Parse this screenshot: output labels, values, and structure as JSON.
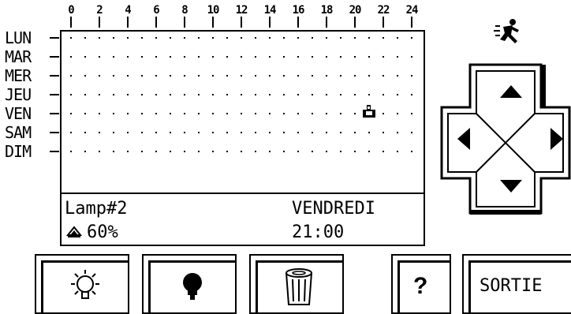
{
  "schedule": {
    "hours": [
      "0",
      "2",
      "4",
      "6",
      "8",
      "10",
      "12",
      "14",
      "16",
      "18",
      "20",
      "22",
      "24"
    ],
    "days": [
      "LUN",
      "MAR",
      "MER",
      "JEU",
      "VEN",
      "SAM",
      "DIM"
    ],
    "selected_day_index": 4,
    "selected_hour": 21
  },
  "info": {
    "lamp_name": "Lamp#2",
    "day_name": "VENDREDI",
    "brightness": "60%",
    "time": "21:00"
  },
  "toolbar": {
    "light_on_icon": "light-bulb-on-icon",
    "light_off_icon": "light-bulb-off-icon",
    "trash_icon": "trash-icon",
    "help_label": "?",
    "exit_label": "SORTIE"
  },
  "status": {
    "running_icon": "running-man-icon"
  }
}
